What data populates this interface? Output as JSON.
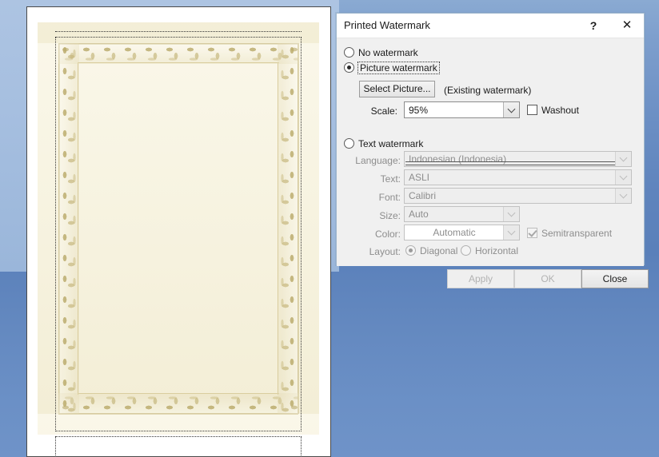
{
  "desktop": {
    "background_top": "#8aaad2",
    "background_bottom": "#6f93c8"
  },
  "document": {
    "name": "word-document-page",
    "page_background": "#ffffff",
    "ornament_color": "#c9bb83",
    "ornament_fill": "#faf7e9",
    "description": "Decorative gold scroll border page with dotted text boundaries"
  },
  "dialog": {
    "title": "Printed Watermark",
    "help_icon": "?",
    "close_icon": "✕",
    "options": {
      "no_watermark": {
        "label": "No watermark",
        "accel": "N",
        "selected": false
      },
      "picture_watermark": {
        "label": "Picture watermark",
        "accel": "i",
        "selected": true,
        "focused": true,
        "select_picture_button": "Select Picture...",
        "existing_note": "(Existing watermark)",
        "scale_label": "Scale:",
        "scale_value": "95%",
        "washout_label": "Washout",
        "washout_accel": "W",
        "washout_checked": false
      },
      "text_watermark": {
        "label": "Text watermark",
        "accel": "x",
        "selected": false,
        "enabled": false,
        "fields": [
          {
            "label": "Language:",
            "value": "Indonesian (Indonesia)"
          },
          {
            "label": "Text:",
            "value": "ASLI"
          },
          {
            "label": "Font:",
            "value": "Calibri"
          },
          {
            "label": "Size:",
            "value": "Auto"
          },
          {
            "label": "Color:",
            "value": "Automatic"
          }
        ],
        "semitransparent_label": "Semitransparent",
        "semitransparent_checked": true,
        "layout_label": "Layout:",
        "layout_diagonal": "Diagonal",
        "layout_horizontal": "Horizontal",
        "layout_selected": "Diagonal"
      }
    },
    "buttons": {
      "apply": {
        "label": "Apply",
        "enabled": false
      },
      "ok": {
        "label": "OK",
        "enabled": false
      },
      "close": {
        "label": "Close",
        "enabled": true
      }
    }
  }
}
